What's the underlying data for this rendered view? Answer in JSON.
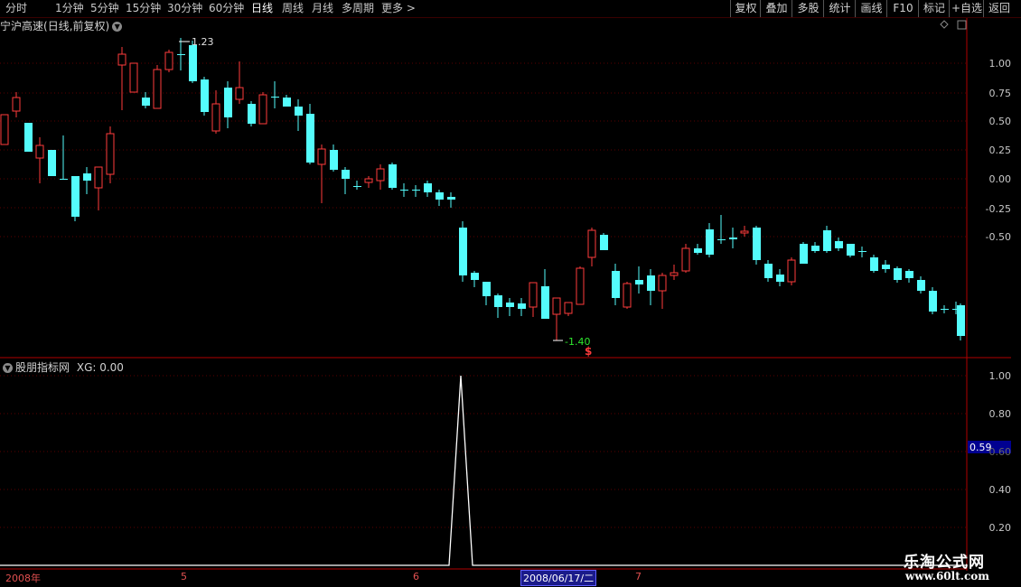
{
  "toolbar": {
    "periods": [
      "分时",
      "1分钟",
      "5分钟",
      "15分钟",
      "30分钟",
      "60分钟",
      "日线",
      "周线",
      "月线",
      "多周期",
      "更多 >"
    ],
    "active_period": "日线",
    "right_buttons": [
      "复权",
      "叠加",
      "多股",
      "统计",
      "画线",
      "F10",
      "标记",
      "+自选",
      "返回"
    ]
  },
  "main_chart": {
    "stock_name": "宁沪高速",
    "mode": "(日线,前复权)",
    "y_labels": [
      "1.00",
      "0.75",
      "0.50",
      "0.25",
      "0.00",
      "-0.25",
      "-0.50"
    ],
    "max_marker": "1.23",
    "min_marker": "-1.40",
    "signal_marker": "$",
    "colors": {
      "up": "#ff3c3c",
      "down": "#54fcfc",
      "grid": "#5a0000",
      "axis": "#b00000"
    }
  },
  "sub_chart": {
    "indicator_name": "股朋指标网",
    "xg_label": "XG: 0.00",
    "y_labels": [
      "1.00",
      "0.80",
      "0.60",
      "0.40",
      "0.20"
    ],
    "current_value": "0.59"
  },
  "date_axis": {
    "labels": [
      "2008年",
      "5",
      "6",
      "7"
    ],
    "cursor_date": "2008/06/17/二"
  },
  "watermark": {
    "line1": "乐淘公式网",
    "line2": "www.60lt.com"
  }
}
